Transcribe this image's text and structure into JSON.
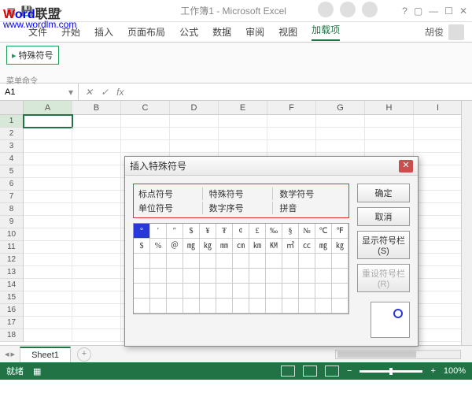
{
  "watermark": {
    "text1": "W",
    "text2": "ord",
    "text3": "联盟",
    "url": "www.wordlm.com"
  },
  "window": {
    "title": "工作簿1 - Microsoft Excel",
    "user": "胡俊"
  },
  "ribbon": {
    "tabs": [
      "文件",
      "开始",
      "插入",
      "页面布局",
      "公式",
      "数据",
      "审阅",
      "视图",
      "加载项"
    ],
    "active": 8,
    "chunk_label": "特殊符号",
    "group_label": "菜单命令"
  },
  "namebox": "A1",
  "columns": [
    "A",
    "B",
    "C",
    "D",
    "E",
    "F",
    "G",
    "H",
    "I"
  ],
  "rows": [
    "1",
    "2",
    "3",
    "4",
    "5",
    "6",
    "7",
    "8",
    "9",
    "10",
    "11",
    "12",
    "13",
    "14",
    "15",
    "16",
    "17",
    "18"
  ],
  "sheet_tab": "Sheet1",
  "status": {
    "ready": "就绪",
    "zoom": "100%"
  },
  "dialog": {
    "title": "插入特殊符号",
    "categories": [
      "标点符号",
      "特殊符号",
      "数学符号",
      "单位符号",
      "数字序号",
      "拼音"
    ],
    "ok": "确定",
    "cancel": "取消",
    "show_bar": "显示符号栏(S)",
    "reset_bar": "重设符号栏(R)",
    "symbols_row1": [
      "°",
      "′",
      "″",
      "$",
      "¥",
      "₮",
      "¢",
      "£",
      "‰",
      "§",
      "№",
      "℃",
      "℉"
    ],
    "symbols_row2": [
      "$",
      "%",
      "＠",
      "㎎",
      "㎏",
      "㎜",
      "㎝",
      "㎞",
      "㏎",
      "㎡",
      "㏄",
      "㎎",
      "㎏"
    ]
  }
}
